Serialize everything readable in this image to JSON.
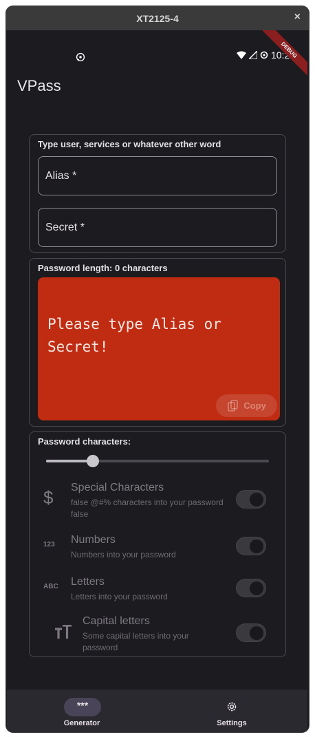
{
  "window": {
    "title": "XT2125-4",
    "close_symbol": "×"
  },
  "status_bar": {
    "time": "10:29",
    "debug_banner": "DEBUG"
  },
  "app": {
    "title": "VPass"
  },
  "inputs_card": {
    "label": "Type user, services or whatever other word",
    "alias_label": "Alias *",
    "secret_label": "Secret *"
  },
  "password_card": {
    "length_label": "Password length: 0 characters",
    "message": "Please type Alias or Secret!",
    "copy_label": "Copy",
    "box_color": "#bf2c12"
  },
  "characters_card": {
    "label": "Password characters:",
    "slider_fraction": 0.21,
    "options": [
      {
        "icon": "dollar-icon",
        "title": "Special Characters",
        "description": "false @#% characters into your password false",
        "enabled": false
      },
      {
        "icon": "numbers-123-icon",
        "title": "Numbers",
        "description": "Numbers into your password",
        "enabled": false
      },
      {
        "icon": "abc-icon",
        "title": "Letters",
        "description": "Letters into your password",
        "enabled": false
      },
      {
        "icon": "capital-letters-icon",
        "title": "Capital letters",
        "description": "Some capital letters into your password",
        "enabled": false
      }
    ]
  },
  "bottom_nav": {
    "items": [
      {
        "label": "Generator",
        "icon": "password-dots-icon",
        "active": true
      },
      {
        "label": "Settings",
        "icon": "gear-icon",
        "active": false
      }
    ]
  },
  "icon_glyphs": {
    "numbers": "123",
    "letters": "ABC",
    "dots": "***"
  }
}
